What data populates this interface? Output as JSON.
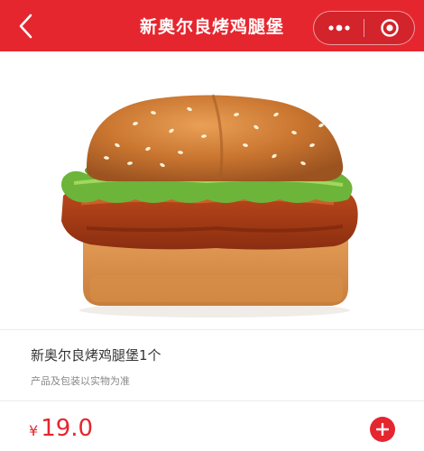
{
  "header": {
    "title": "新奥尔良烤鸡腿堡",
    "back_icon": "chevron-left-icon",
    "more_icon": "more-dots-icon",
    "close_icon": "target-circle-icon",
    "bg_color": "#e5262f"
  },
  "product": {
    "image": "burger-photo",
    "name": "新奥尔良烤鸡腿堡1个",
    "note": "产品及包装以实物为准",
    "currency": "¥",
    "price": "19.0",
    "add_icon": "plus-circle-icon",
    "accent_color": "#e5262f"
  }
}
